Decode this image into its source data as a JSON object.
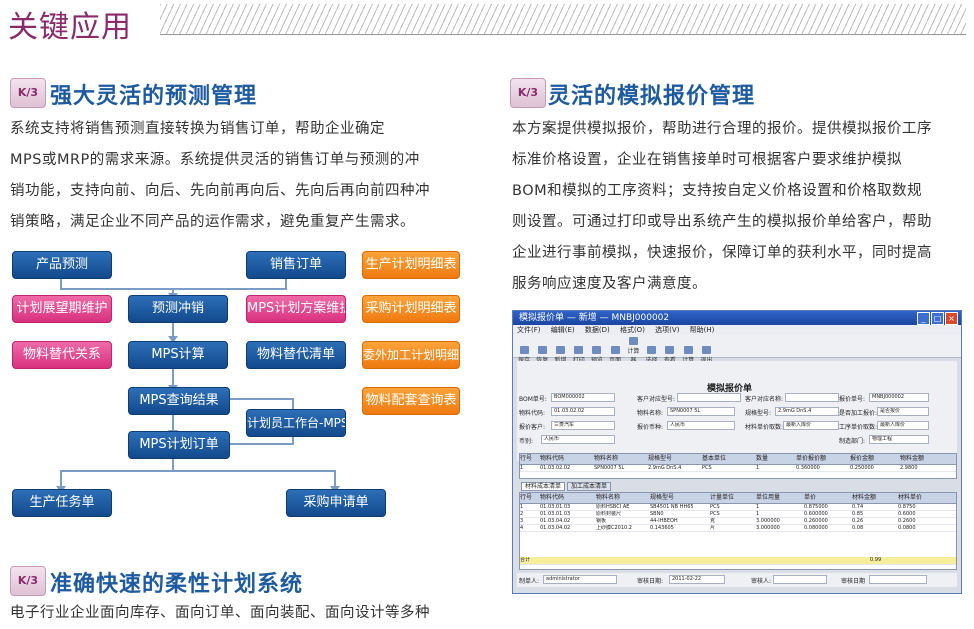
{
  "page_title": "关键应用",
  "badge_text": "K/3",
  "section1": {
    "heading": "强大灵活的预测管理",
    "lines": [
      "系统支持将销售预测直接转换为销售订单，帮助企业确定",
      "MPS或MRP的需求来源。系统提供灵活的销售订单与预测的冲",
      "销功能，支持向前、向后、先向前再向后、先向后再向前四种冲",
      "销策略，满足企业不同产品的运作需求，避免重复产生需求。"
    ]
  },
  "flow": {
    "product_forecast": "产品预测",
    "sales_order": "销售订单",
    "plan_report": "生产计划明细表",
    "plan_window": "计划展望期维护",
    "forecast_offset": "预测冲销",
    "mps_plan": "MPS计划方案维护",
    "purchase_report": "采购计划明细表",
    "material_sub": "物料替代关系",
    "mps_calc": "MPS计算",
    "material_sub_list": "物料替代清单",
    "outsource_report": "委外加工计划明细表",
    "mps_query": "MPS查询结果",
    "material_query": "物料配套查询表",
    "plan_workbench": "计划员工作台-MPS",
    "mps_order": "MPS计划订单",
    "production_task": "生产任务单",
    "purchase_request": "采购申请单"
  },
  "section2": {
    "heading": "灵活的模拟报价管理",
    "lines": [
      "本方案提供模拟报价，帮助进行合理的报价。提供模拟报价工序",
      "标准价格设置，企业在销售接单时可根据客户要求维护模拟",
      "BOM和模拟的工序资料；支持按自定义价格设置和价格取数规",
      "则设置。可通过打印或导出系统产生的模拟报价单给客户，帮助",
      "企业进行事前模拟，快速报价，保障订单的获利水平，同时提高",
      "服务响应速度及客户满意度。"
    ]
  },
  "section3": {
    "heading": "准确快速的柔性计划系统",
    "lines": [
      "电子行业企业面向库存、面向订单、面向装配、面向设计等多种"
    ]
  },
  "window": {
    "title": "模拟报价单  — 新增  — MNBJ000002",
    "menu": [
      "文件(F)",
      "编辑(E)",
      "数据(D)",
      "格式(O)",
      "选项(V)",
      "帮助(H)"
    ],
    "toolbar": [
      "保存",
      "恢复",
      "新增",
      "打印",
      "预览",
      "页面",
      "计算器",
      "选择",
      "查看",
      "计算",
      "退出"
    ],
    "doc_heading": "模拟报价单",
    "fields": [
      {
        "label": "BOM单号:",
        "value": "BOM000002"
      },
      {
        "label": "客户对应型号:",
        "value": ""
      },
      {
        "label": "客户对应名称:",
        "value": ""
      },
      {
        "label": "报价单号:",
        "value": "MNBJ000002"
      },
      {
        "label": "物料代码:",
        "value": "01.03.02.02"
      },
      {
        "label": "物料名称:",
        "value": "SPN0007 5L"
      },
      {
        "label": "规格型号:",
        "value": "2.9mG DnS.4"
      },
      {
        "label": "是否加工报价:",
        "value": "是否报价"
      },
      {
        "label": "报价客户:",
        "value": "三菱汽车"
      },
      {
        "label": "报价币种:",
        "value": "人民币"
      },
      {
        "label": "材料单价取数:",
        "value": "最新入库价"
      },
      {
        "label": "工序单价取数:",
        "value": "最新人库价"
      },
      {
        "label": "币别:",
        "value": "人民币"
      },
      {
        "label": "制造部门:",
        "value": "物理工程"
      }
    ],
    "top_grid_headers": [
      "行号",
      "物料代码",
      "物料名称",
      "规格型号",
      "基本单位",
      "数量",
      "单价报价额",
      "报价金额",
      "物料金额"
    ],
    "top_grid_row": [
      "1",
      "01.03.02.02",
      "SPN0007 5L",
      "2.9mG DnS.4",
      "PCS",
      "1",
      "0.360000",
      "0.250000",
      "2.9800"
    ],
    "tabs": [
      "材料成本清单",
      "加工成本清单"
    ],
    "bottom_grid_headers": [
      "行号",
      "物料代码",
      "物料名称",
      "规格型号",
      "计量单位",
      "单位用量",
      "单价",
      "材料金额",
      "材料单价"
    ],
    "bottom_grid_rows": [
      [
        "1",
        "01.03.01.03",
        "原料HSBCI AE",
        "SB4501 NB HH65",
        "PCS",
        "1",
        "0.875000",
        "0.74",
        "0.8750"
      ],
      [
        "2",
        "01.03.01.03",
        "原料封装尺",
        "SBN0",
        "PCS",
        "1",
        "0.600000",
        "0.85",
        "0.6000"
      ],
      [
        "3",
        "01.03.04.02",
        "钢板",
        "44-IHBEOH",
        "克",
        "3.000000",
        "0.260000",
        "0.26",
        "0.2600"
      ],
      [
        "4",
        "01.03.04.02",
        "上砂膜C2010.2",
        "0.143605",
        "片",
        "3.000000",
        "0.080000",
        "0.08",
        "0.0800"
      ]
    ],
    "total_label": "合计",
    "total_value": "0.99",
    "status": {
      "maker_label": "制单人:",
      "maker_value": "administrator",
      "date_label": "审核日期:",
      "date_value": "2011-02-22",
      "reviewer_label": "审核人:",
      "review_date_label": "审核日期"
    }
  }
}
